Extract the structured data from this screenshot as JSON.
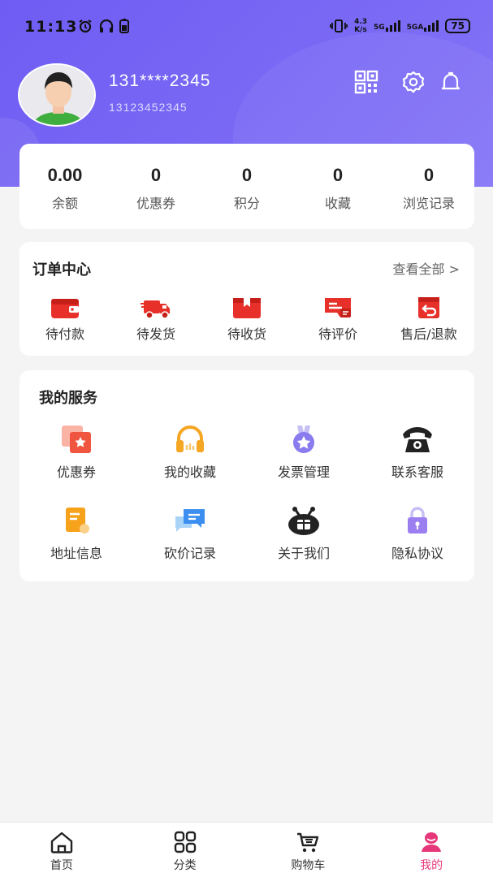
{
  "status_bar": {
    "time": "11:13",
    "speed": "4.3\nK/s",
    "signal1": "5G",
    "signal2": "5GA",
    "battery": "75"
  },
  "profile": {
    "username": "131****2345",
    "phone": "13123452345"
  },
  "header_icons": [
    "qr-code-icon",
    "settings-gear-icon",
    "bell-icon"
  ],
  "stats": [
    {
      "value": "0.00",
      "label": "余额"
    },
    {
      "value": "0",
      "label": "优惠券"
    },
    {
      "value": "0",
      "label": "积分"
    },
    {
      "value": "0",
      "label": "收藏"
    },
    {
      "value": "0",
      "label": "浏览记录"
    }
  ],
  "orders": {
    "title": "订单中心",
    "view_all": "查看全部 >",
    "items": [
      {
        "label": "待付款",
        "icon": "wallet-icon"
      },
      {
        "label": "待发货",
        "icon": "truck-icon"
      },
      {
        "label": "待收货",
        "icon": "package-icon"
      },
      {
        "label": "待评价",
        "icon": "comment-card-icon"
      },
      {
        "label": "售后/退款",
        "icon": "refund-icon"
      }
    ]
  },
  "services": {
    "title": "我的服务",
    "items": [
      {
        "label": "优惠券",
        "icon": "coupon-icon"
      },
      {
        "label": "我的收藏",
        "icon": "headphones-icon"
      },
      {
        "label": "发票管理",
        "icon": "medal-icon"
      },
      {
        "label": "联系客服",
        "icon": "telephone-icon"
      },
      {
        "label": "地址信息",
        "icon": "address-card-icon"
      },
      {
        "label": "砍价记录",
        "icon": "chat-bubbles-icon"
      },
      {
        "label": "关于我们",
        "icon": "gift-face-icon"
      },
      {
        "label": "隐私协议",
        "icon": "lock-icon"
      }
    ]
  },
  "tabbar": [
    {
      "label": "首页",
      "icon": "home-icon",
      "active": false
    },
    {
      "label": "分类",
      "icon": "grid-icon",
      "active": false
    },
    {
      "label": "购物车",
      "icon": "cart-icon",
      "active": false
    },
    {
      "label": "我的",
      "icon": "user-icon",
      "active": true
    }
  ],
  "colors": {
    "header": "#7462f4",
    "accent_red": "#e8302a",
    "tab_active": "#e6377a"
  }
}
